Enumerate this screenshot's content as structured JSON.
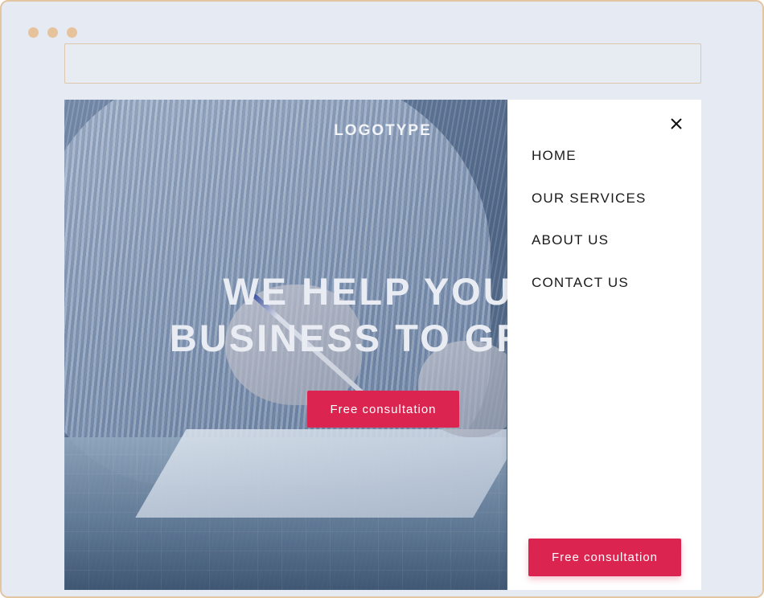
{
  "browser": {
    "address_bar_value": ""
  },
  "hero": {
    "logotype": "LOGOTYPE",
    "headline_line1": "WE HELP YOUR",
    "headline_line2": "BUSINESS TO GROW",
    "cta_label": "Free consultation"
  },
  "menu": {
    "close_icon": "close-icon",
    "items": [
      {
        "label": "HOME"
      },
      {
        "label": "OUR SERVICES"
      },
      {
        "label": "ABOUT US"
      },
      {
        "label": "CONTACT US"
      }
    ],
    "cta_label": "Free consultation"
  },
  "colors": {
    "accent": "#dc2450",
    "frame_border": "#e3c6a1",
    "window_dots": "#e6c29d",
    "background": "#e6eaf2"
  }
}
